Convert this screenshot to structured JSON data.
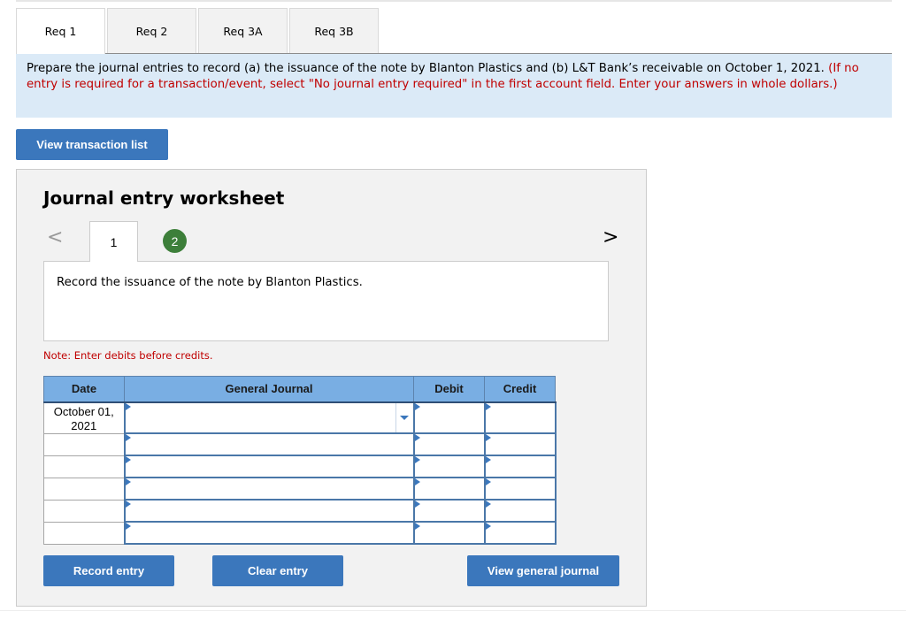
{
  "tabs": [
    {
      "label": "Req 1",
      "active": true
    },
    {
      "label": "Req 2",
      "active": false
    },
    {
      "label": "Req 3A",
      "active": false
    },
    {
      "label": "Req 3B",
      "active": false
    }
  ],
  "instructions": {
    "main": "Prepare the journal entries to record (a) the issuance of the note by Blanton Plastics and (b) L&T Bank’s receivable on October 1, 2021.",
    "note": "(If no entry is required for a transaction/event, select \"No journal entry required\" in the first account field. Enter your answers in whole dollars.)"
  },
  "buttons": {
    "view_transactions": "View transaction list",
    "record_entry": "Record entry",
    "clear_entry": "Clear entry",
    "view_general_journal": "View general journal"
  },
  "worksheet": {
    "title": "Journal entry worksheet",
    "nav_prev": "<",
    "nav_next": ">",
    "steps": [
      "1",
      "2"
    ],
    "current_step": "1",
    "description": "Record the issuance of the note by Blanton Plastics.",
    "note": "Note: Enter debits before credits."
  },
  "table": {
    "headers": [
      "Date",
      "General Journal",
      "Debit",
      "Credit"
    ],
    "rows": [
      {
        "date": "October 01, 2021",
        "account": "",
        "debit": "",
        "credit": ""
      },
      {
        "date": "",
        "account": "",
        "debit": "",
        "credit": ""
      },
      {
        "date": "",
        "account": "",
        "debit": "",
        "credit": ""
      },
      {
        "date": "",
        "account": "",
        "debit": "",
        "credit": ""
      },
      {
        "date": "",
        "account": "",
        "debit": "",
        "credit": ""
      },
      {
        "date": "",
        "account": "",
        "debit": "",
        "credit": ""
      }
    ]
  },
  "colors": {
    "accent": "#3b77bc",
    "header_bg": "#79aee3",
    "instruction_bg": "#dbeaf7",
    "warning": "#c00000",
    "badge": "#3d7f3a"
  }
}
